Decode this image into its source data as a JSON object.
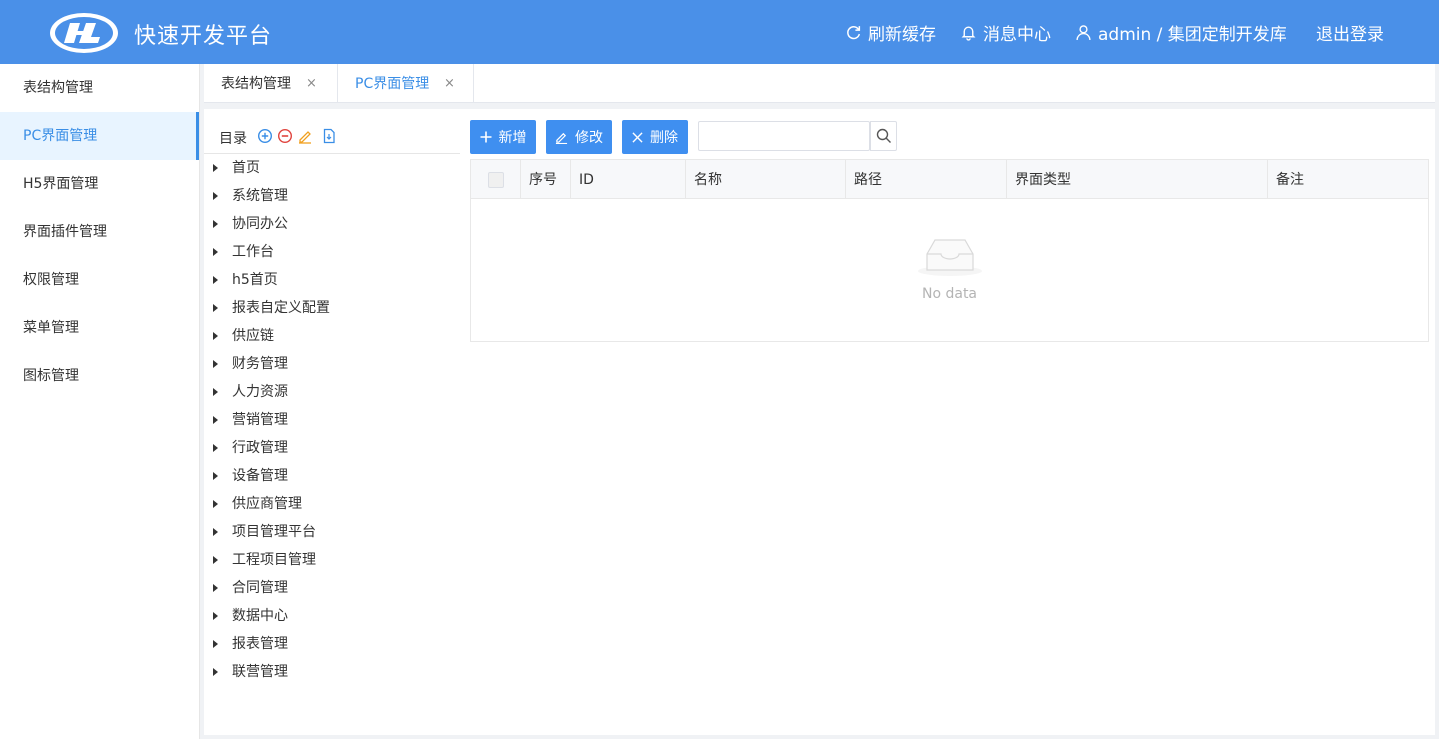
{
  "header": {
    "app_title": "快速开发平台",
    "refresh_label": "刷新缓存",
    "messages_label": "消息中心",
    "user_label": "admin / 集团定制开发库",
    "logout_label": "退出登录"
  },
  "sidebar": {
    "items": [
      {
        "label": "表结构管理"
      },
      {
        "label": "PC界面管理"
      },
      {
        "label": "H5界面管理"
      },
      {
        "label": "界面插件管理"
      },
      {
        "label": "权限管理"
      },
      {
        "label": "菜单管理"
      },
      {
        "label": "图标管理"
      }
    ],
    "active_index": 1
  },
  "tabs": [
    {
      "label": "表结构管理",
      "close": "×"
    },
    {
      "label": "PC界面管理",
      "close": "×"
    }
  ],
  "tree": {
    "title": "目录",
    "nodes": [
      "首页",
      "系统管理",
      "协同办公",
      "工作台",
      "h5首页",
      "报表自定义配置",
      "供应链",
      "财务管理",
      "人力资源",
      "营销管理",
      "行政管理",
      "设备管理",
      "供应商管理",
      "项目管理平台",
      "工程项目管理",
      "合同管理",
      "数据中心",
      "报表管理",
      "联营管理"
    ]
  },
  "toolbar": {
    "add_label": "新增",
    "edit_label": "修改",
    "delete_label": "删除",
    "search_value": ""
  },
  "table": {
    "columns": [
      "序号",
      "ID",
      "名称",
      "路径",
      "界面类型",
      "备注"
    ],
    "rows": [],
    "empty_text": "No data"
  },
  "colors": {
    "header_bg": "#4a90e8",
    "accent": "#3a8ee6",
    "button_bg": "#3f8ff0"
  }
}
